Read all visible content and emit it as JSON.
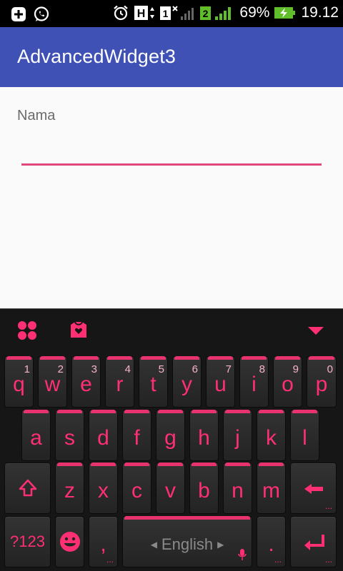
{
  "status_bar": {
    "battery_percent": "69%",
    "time": "19.12",
    "network_type": "H",
    "sim1": "1",
    "sim2": "2",
    "icons": [
      "add-icon",
      "whatsapp-icon",
      "alarm-icon",
      "network-h-icon",
      "sim1-no-signal-icon",
      "sim2-signal-icon",
      "battery-charging-icon"
    ]
  },
  "app_bar": {
    "title": "AdvancedWidget3"
  },
  "form": {
    "label": "Nama",
    "value": ""
  },
  "keyboard": {
    "accent_color": "#ff2f74",
    "toolbar": [
      "apps-icon",
      "theme-shop-icon",
      "hide-keyboard-icon"
    ],
    "row1": [
      {
        "key": "q",
        "hint": "1"
      },
      {
        "key": "w",
        "hint": "2"
      },
      {
        "key": "e",
        "hint": "3"
      },
      {
        "key": "r",
        "hint": "4"
      },
      {
        "key": "t",
        "hint": "5"
      },
      {
        "key": "y",
        "hint": "6"
      },
      {
        "key": "u",
        "hint": "7"
      },
      {
        "key": "i",
        "hint": "8"
      },
      {
        "key": "o",
        "hint": "9"
      },
      {
        "key": "p",
        "hint": "0"
      }
    ],
    "row2": [
      "a",
      "s",
      "d",
      "f",
      "g",
      "h",
      "j",
      "k",
      "l"
    ],
    "row3": [
      "z",
      "x",
      "c",
      "v",
      "b",
      "n",
      "m"
    ],
    "bottom": {
      "symbols": "?123",
      "comma": ",",
      "space_label": "English",
      "period": "."
    }
  }
}
